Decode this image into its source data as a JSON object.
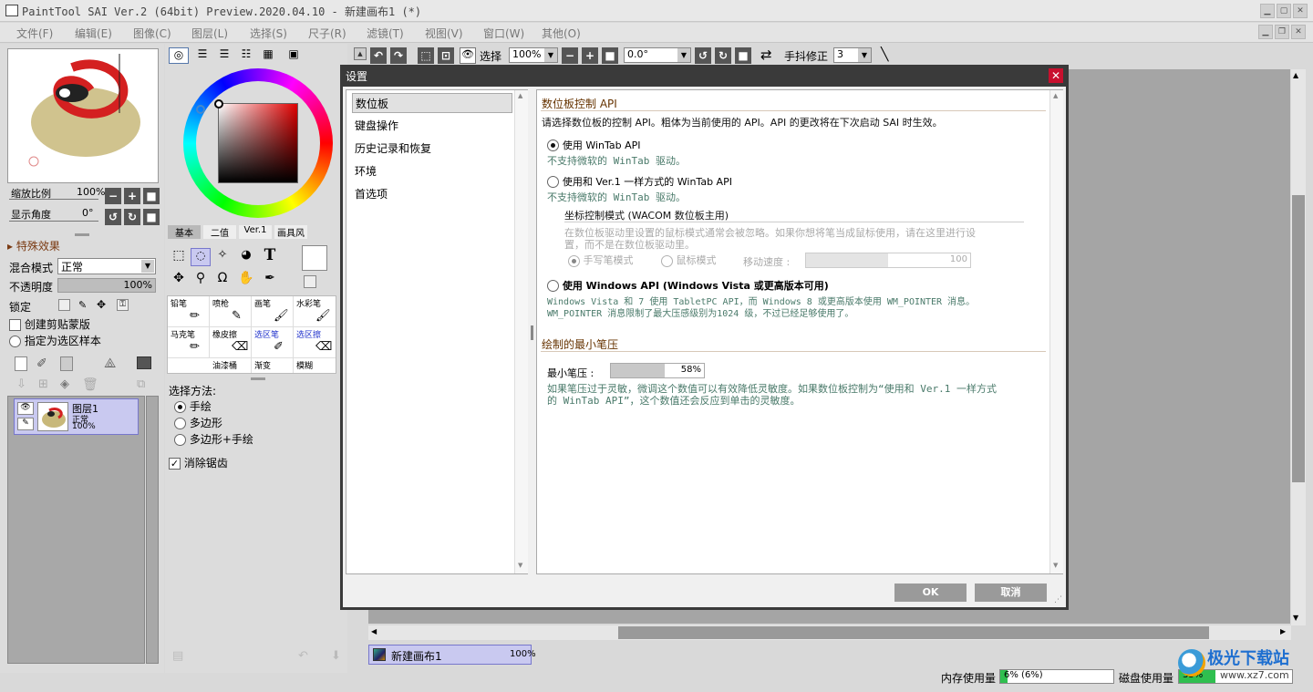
{
  "window": {
    "title": "PaintTool SAI Ver.2 (64bit) Preview.2020.04.10 - 新建画布1 (*)"
  },
  "menu": [
    "文件(F)",
    "编辑(E)",
    "图像(C)",
    "图层(L)",
    "选择(S)",
    "尺子(R)",
    "滤镜(T)",
    "视图(V)",
    "窗口(W)",
    "其他(O)"
  ],
  "navigator": {
    "zoom_label": "缩放比例",
    "zoom_value": "100%",
    "angle_label": "显示角度",
    "angle_value": "0°"
  },
  "layer_panel": {
    "effects_label": "特殊效果",
    "blend_label": "混合模式",
    "blend_value": "正常",
    "opacity_label": "不透明度",
    "opacity_value": "100%",
    "lock_label": "锁定",
    "clip_label": "创建剪贴蒙版",
    "sample_label": "指定为选区样本",
    "layer_name": "图层1",
    "layer_mode": "正常",
    "layer_opacity": "100%"
  },
  "color_tabs": [
    "基本",
    "二值",
    "Ver.1",
    "画具风"
  ],
  "brushes": [
    [
      "铅笔",
      "喷枪",
      "画笔",
      "水彩笔"
    ],
    [
      "马克笔",
      "橡皮擦",
      "选区笔",
      "选区擦"
    ],
    [
      "",
      "油漆桶",
      "渐变",
      "模糊"
    ]
  ],
  "selection": {
    "method_label": "选择方法:",
    "opt1": "手绘",
    "opt2": "多边形",
    "opt3": "多边形+手绘",
    "antialias": "消除锯齿"
  },
  "toolbar": {
    "select_label": "选择",
    "zoom": "100%",
    "angle": "0.0°",
    "stabilizer_label": "手抖修正",
    "stabilizer_value": "3"
  },
  "dialog": {
    "title": "设置",
    "categories": [
      "数位板",
      "键盘操作",
      "历史记录和恢复",
      "环境",
      "首选项"
    ],
    "sec1_title": "数位板控制 API",
    "sec1_intro": "请选择数位板的控制 API。粗体为当前使用的 API。API 的更改将在下次启动 SAI 时生效。",
    "opt_wintab": "使用 WinTab API",
    "opt_wintab_desc": "不支持微软的 WinTab 驱动。",
    "opt_wintab_v1": "使用和 Ver.1 一样方式的 WinTab API",
    "opt_wintab_v1_desc": "不支持微软的 WinTab 驱动。",
    "coord_title": "坐标控制模式 (WACOM 数位板主用)",
    "coord_desc1": "在数位板驱动里设置的鼠标模式通常会被忽略。如果你想将笔当成鼠标使用，请在这里进行设",
    "coord_desc2": "置，而不是在数位板驱动里。",
    "pen_mode": "手写笔模式",
    "mouse_mode": "鼠标模式",
    "move_speed_label": "移动速度 :",
    "move_speed_value": "100",
    "opt_windows": "使用 Windows API (Windows Vista 或更高版本可用)",
    "opt_windows_desc1": "Windows Vista 和 7 使用 TabletPC API，而 Windows 8 或更高版本使用 WM_POINTER 消息。",
    "opt_windows_desc2": "WM_POINTER 消息限制了最大压感级别为1024 级，不过已经足够使用了。",
    "sec2_title": "绘制的最小笔压",
    "min_pressure_label": "最小笔压 :",
    "min_pressure_value": "58%",
    "min_pressure_fraction": 0.58,
    "min_desc1": "如果笔压过于灵敏，微调这个数值可以有效降低灵敏度。如果数位板控制为“使用和 Ver.1 一样方式",
    "min_desc2": "的 WinTab API”，这个数值还会反应到单击的灵敏度。",
    "ok": "OK",
    "cancel": "取消"
  },
  "canvas_tab": {
    "name": "新建画布1",
    "zoom": "100%"
  },
  "status": {
    "memory_label": "内存使用量",
    "memory_value": "6% (6%)",
    "disk_label": "磁盘使用量",
    "disk_value": "33%"
  },
  "watermark": {
    "brand": "极光下载站",
    "url": "www.xz7.com"
  },
  "colors": {
    "accent_close": "#c8102e",
    "selected_layer": "#c9c9f0"
  }
}
